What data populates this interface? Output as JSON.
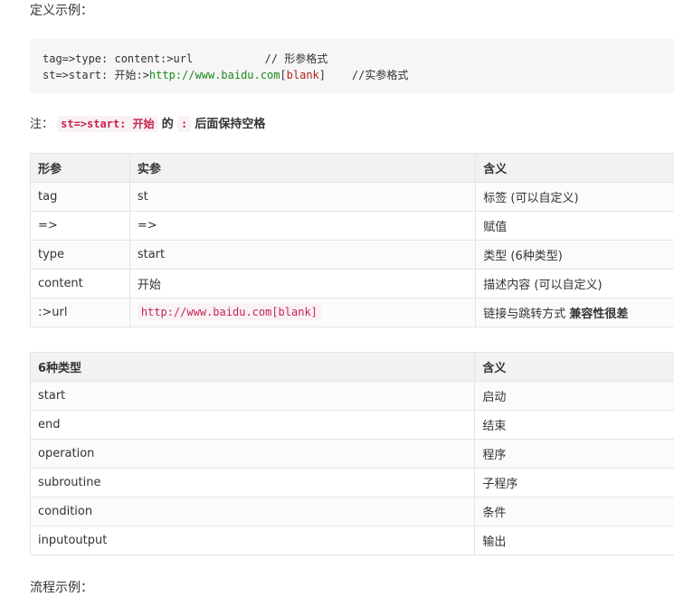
{
  "intro": "定义示例：",
  "code": {
    "line1": "tag=>type: content:>url           // 形参格式",
    "line2_prefix": "st=>start: 开始:>",
    "line2_url": "http://www.baidu.com",
    "line2_bracket_open": "[",
    "line2_blank": "blank",
    "line2_bracket_close": "]",
    "line2_comment": "    //实参格式"
  },
  "note": {
    "label": "注：",
    "code": "st=>start: 开始",
    "middle": "的",
    "colon_code": ":",
    "tail": "后面保持空格"
  },
  "params_table": {
    "headers": [
      "形参",
      "实参",
      "含义"
    ],
    "rows": [
      {
        "param": "tag",
        "arg": "st",
        "meaning": "标签 (可以自定义)"
      },
      {
        "param": "=>",
        "arg": "=>",
        "meaning": "赋值"
      },
      {
        "param": "type",
        "arg": "start",
        "meaning": "类型 (6种类型)"
      },
      {
        "param": "content",
        "arg": "开始",
        "meaning": "描述内容 (可以自定义)"
      },
      {
        "param": ":>url",
        "arg": "http://www.baidu.com[blank]",
        "meaning": "链接与跳转方式 ",
        "meaning_bold": "兼容性很差"
      }
    ]
  },
  "types_table": {
    "headers": [
      "6种类型",
      "含义"
    ],
    "rows": [
      {
        "type": "start",
        "meaning": "启动"
      },
      {
        "type": "end",
        "meaning": "结束"
      },
      {
        "type": "operation",
        "meaning": "程序"
      },
      {
        "type": "subroutine",
        "meaning": "子程序"
      },
      {
        "type": "condition",
        "meaning": "条件"
      },
      {
        "type": "inputoutput",
        "meaning": "输出"
      }
    ]
  },
  "cutoff_text": "流程示例："
}
